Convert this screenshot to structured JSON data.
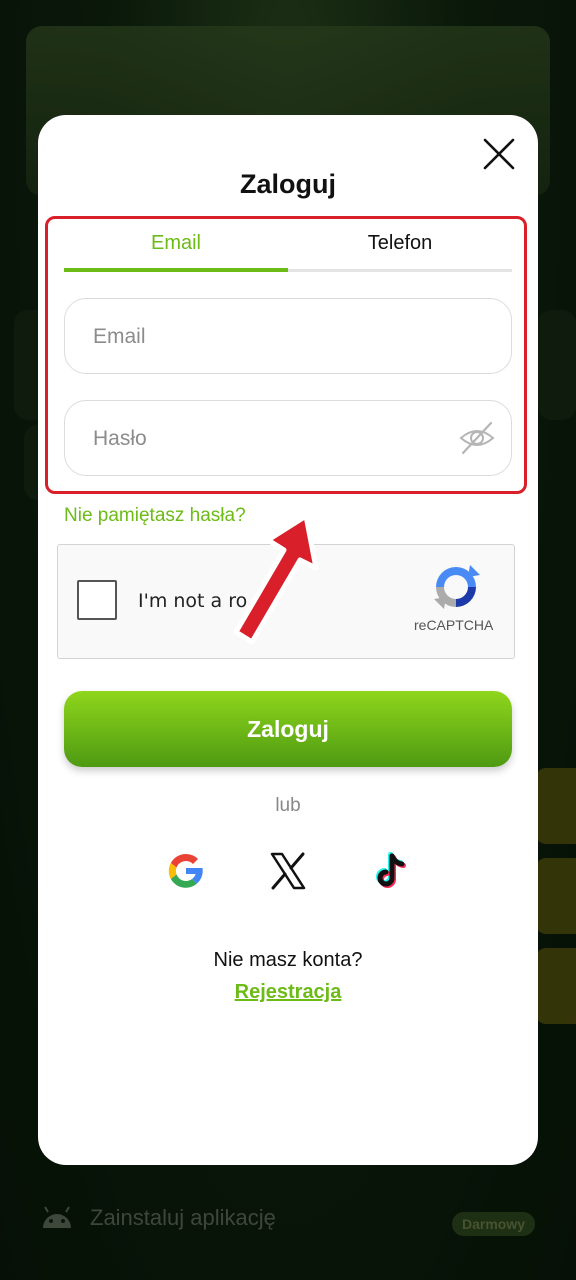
{
  "modal": {
    "title": "Zaloguj",
    "close_icon": "close-icon"
  },
  "tabs": [
    {
      "label": "Email",
      "active": true
    },
    {
      "label": "Telefon",
      "active": false
    }
  ],
  "form": {
    "email_placeholder": "Email",
    "email_value": "",
    "password_placeholder": "Hasło",
    "password_value": "",
    "password_toggle_icon": "eye-off-icon",
    "forgot_password": "Nie pamiętasz hasła?",
    "submit_label": "Zaloguj"
  },
  "recaptcha": {
    "label": "I'm not a ro",
    "brand": "reCAPTCHA",
    "checked": false
  },
  "social": {
    "separator": "lub",
    "providers": [
      "google-icon",
      "x-icon",
      "tiktok-icon"
    ]
  },
  "footer": {
    "no_account": "Nie masz konta?",
    "register_link": "Rejestracja"
  },
  "background": {
    "install_text": "Zainstaluj aplikację",
    "install_badge": "Darmowy"
  },
  "colors": {
    "accent": "#6cbb16",
    "highlight": "#d81f2a"
  }
}
